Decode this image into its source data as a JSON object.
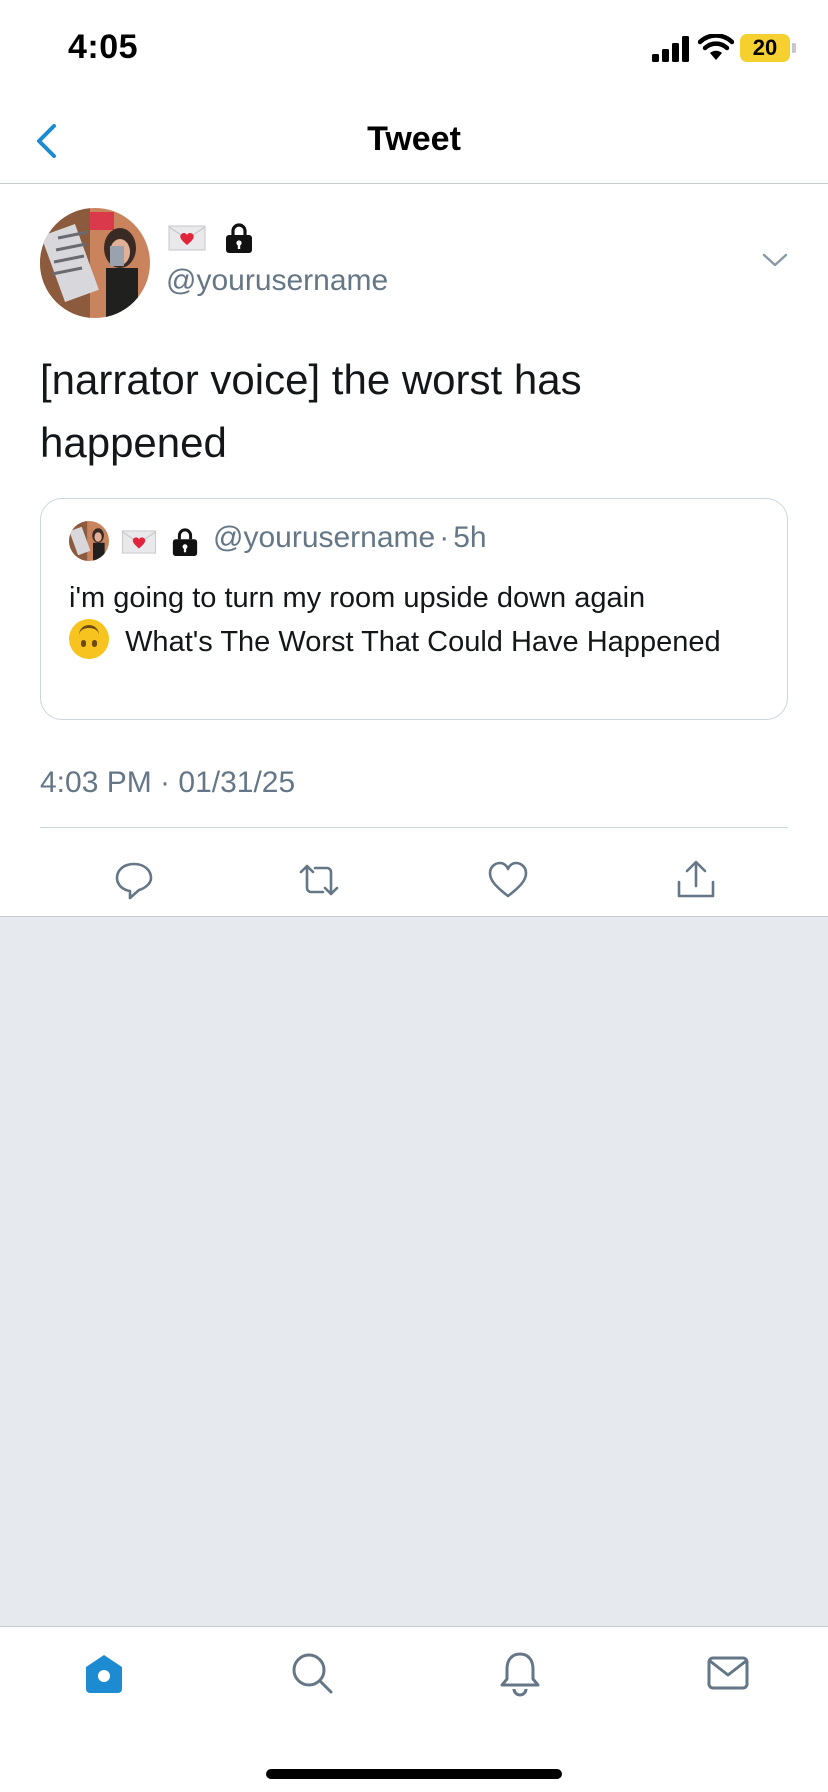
{
  "status_bar": {
    "time": "4:05",
    "battery": "20"
  },
  "nav": {
    "title": "Tweet"
  },
  "tweet": {
    "handle": "@yourusername",
    "name_icons": [
      "love-letter-icon",
      "lock-icon"
    ],
    "text": "[narrator voice] the worst has happened",
    "quoted": {
      "handle": "@yourusername",
      "separator": "·",
      "time_ago": "5h",
      "text_line_1": "i'm going to turn my room upside down again",
      "text_rest": "What's The Worst That Could Have Happened",
      "emoji": "upside-down-face-icon"
    },
    "timestamp": "4:03 PM · 01/31/25"
  },
  "actions": [
    "reply-icon",
    "retweet-icon",
    "like-icon",
    "share-icon"
  ],
  "tab_bar": [
    "home-icon",
    "search-icon",
    "notifications-icon",
    "messages-icon"
  ],
  "colors": {
    "accent": "#1d8bd1",
    "secondary_text": "#657786",
    "border": "#ccd6dd",
    "empty_bg": "#e6e9ee"
  }
}
